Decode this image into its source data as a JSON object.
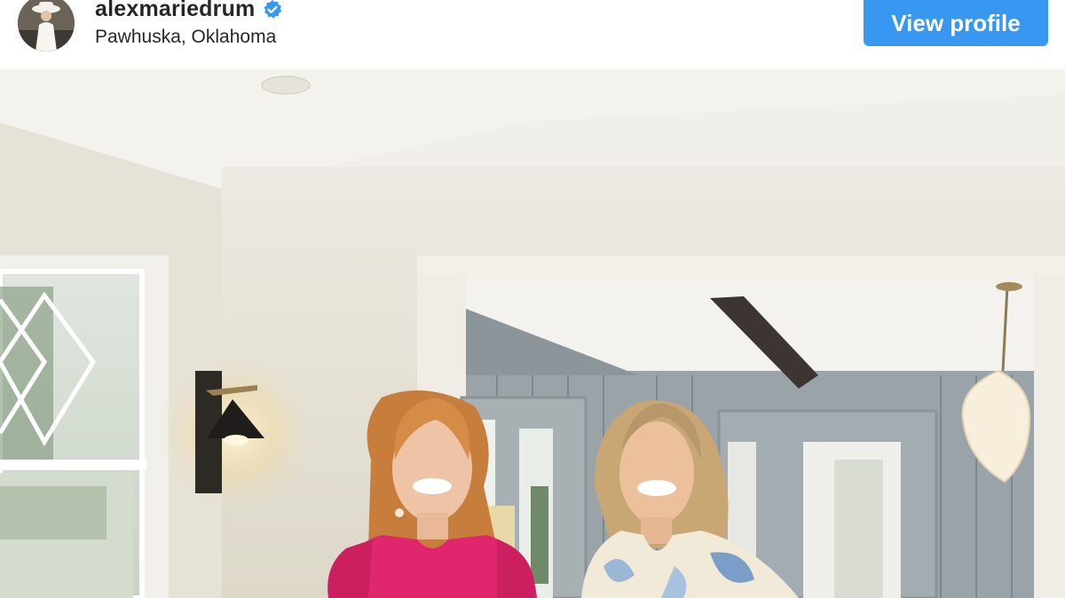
{
  "post_header": {
    "username": "alexmariedrum",
    "verified": true,
    "location": "Pawhuska, Oklahoma",
    "view_profile_label": "View profile",
    "button_color": "#3897f0"
  },
  "icons": {
    "verified": "verified-badge-icon",
    "avatar": "profile-avatar"
  },
  "photo": {
    "description_icon": "post-photo"
  }
}
